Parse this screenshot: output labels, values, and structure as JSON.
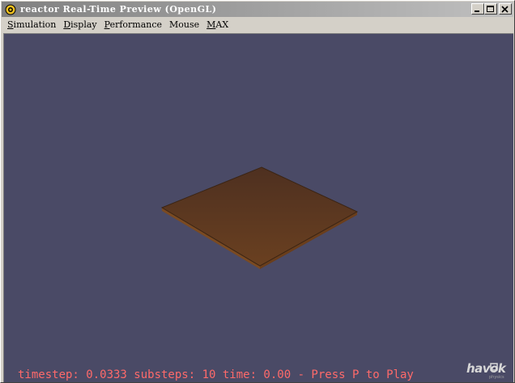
{
  "window": {
    "title": "reactor Real-Time Preview (OpenGL)",
    "controls": {
      "minimize_icon": "minimize-icon",
      "maximize_icon": "maximize-icon",
      "close_icon": "close-icon"
    }
  },
  "menu": {
    "items": [
      {
        "label_ul": "S",
        "label_rest": "imulation"
      },
      {
        "label_ul": "D",
        "label_rest": "isplay"
      },
      {
        "label_ul": "P",
        "label_rest": "erformance"
      },
      {
        "label_ul": "",
        "label_rest": "Mouse"
      },
      {
        "label_ul": "M",
        "label_rest": "AX"
      }
    ]
  },
  "viewport": {
    "background_color": "#4a4a66",
    "plane_color": "#5c3a1e",
    "status_text": "timestep: 0.0333 substeps: 10 time: 0.00 - Press P to Play",
    "status_color": "#ff6a6a"
  },
  "logo": {
    "text": "havok"
  }
}
